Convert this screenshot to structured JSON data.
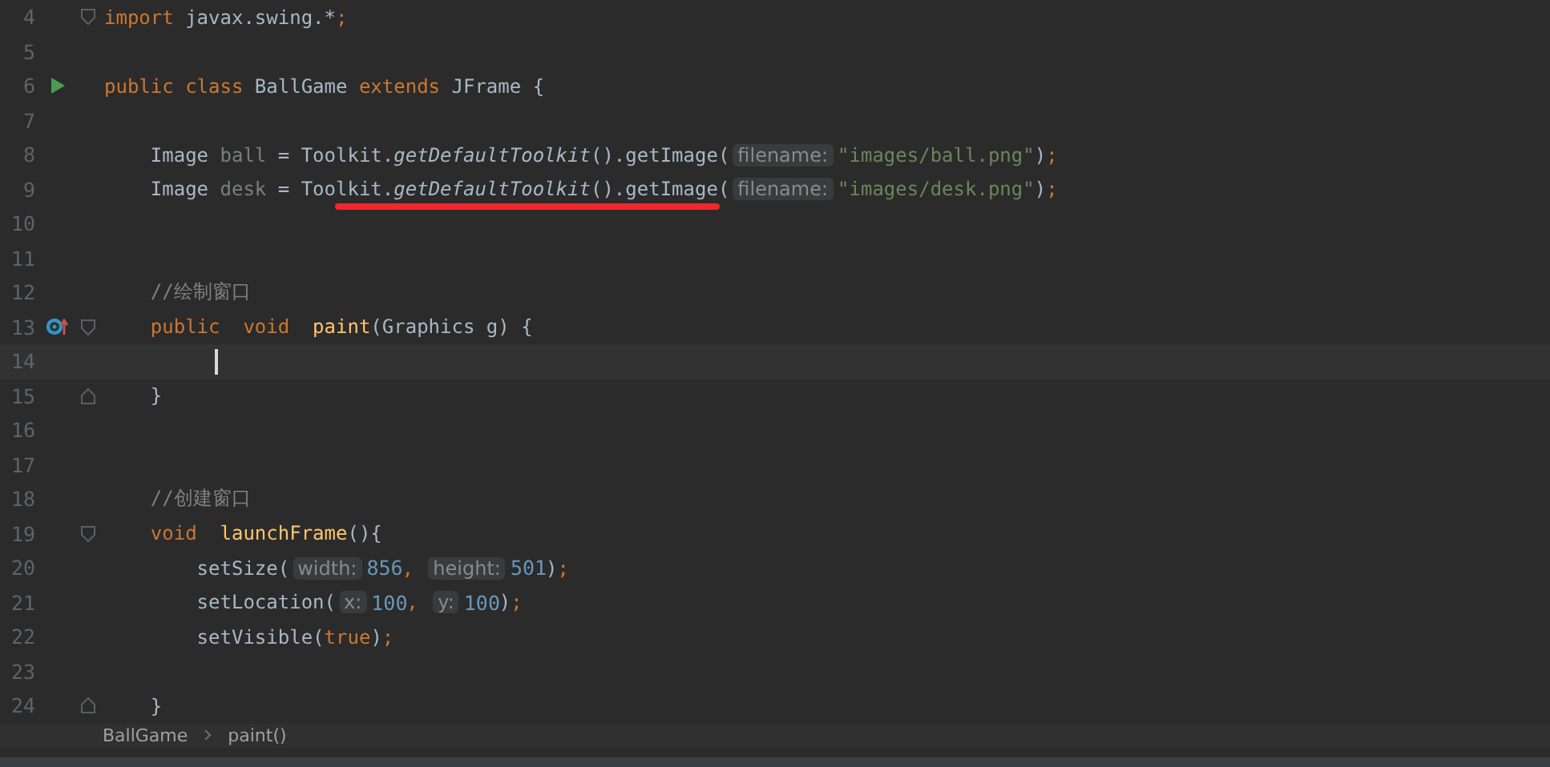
{
  "editor": {
    "lines": [
      {
        "number": "4",
        "fold_start": true,
        "tokens": [
          {
            "kind": "keyword",
            "text": "import "
          },
          {
            "kind": "plain",
            "text": "javax.swing.*"
          },
          {
            "kind": "keyword",
            "text": ";"
          }
        ]
      },
      {
        "number": "5"
      },
      {
        "number": "6",
        "runnable": true,
        "tokens": [
          {
            "kind": "keyword",
            "text": "public class "
          },
          {
            "kind": "plain",
            "text": "BallGame "
          },
          {
            "kind": "keyword",
            "text": "extends "
          },
          {
            "kind": "plain",
            "text": "JFrame {"
          }
        ]
      },
      {
        "number": "7"
      },
      {
        "number": "8",
        "tokens": [
          {
            "kind": "plain",
            "text": "    Image "
          },
          {
            "kind": "unused",
            "text": "ball"
          },
          {
            "kind": "plain",
            "text": " = Toolkit."
          },
          {
            "kind": "static",
            "text": "getDefaultToolkit"
          },
          {
            "kind": "plain",
            "text": "().getImage("
          },
          {
            "kind": "hint",
            "text": "filename:"
          },
          {
            "kind": "string",
            "text": "\"images/ball.png\""
          },
          {
            "kind": "plain",
            "text": ")"
          },
          {
            "kind": "keyword",
            "text": ";"
          }
        ]
      },
      {
        "number": "9",
        "underline": true,
        "tokens": [
          {
            "kind": "plain",
            "text": "    Image "
          },
          {
            "kind": "unused",
            "text": "desk"
          },
          {
            "kind": "plain",
            "text": " = Toolkit."
          },
          {
            "kind": "static",
            "text": "getDefaultToolkit"
          },
          {
            "kind": "plain",
            "text": "().getImage("
          },
          {
            "kind": "hint",
            "text": "filename:"
          },
          {
            "kind": "string",
            "text": "\"images/desk.png\""
          },
          {
            "kind": "plain",
            "text": ")"
          },
          {
            "kind": "keyword",
            "text": ";"
          }
        ]
      },
      {
        "number": "10"
      },
      {
        "number": "11"
      },
      {
        "number": "12",
        "tokens": [
          {
            "kind": "comment",
            "text": "    //绘制窗口"
          }
        ]
      },
      {
        "number": "13",
        "overrides": true,
        "fold_start": true,
        "tokens": [
          {
            "kind": "keyword",
            "text": "    public  void  "
          },
          {
            "kind": "method",
            "text": "paint"
          },
          {
            "kind": "plain",
            "text": "(Graphics g) {"
          }
        ]
      },
      {
        "number": "14",
        "current": true
      },
      {
        "number": "15",
        "fold_end": true,
        "tokens": [
          {
            "kind": "plain",
            "text": "    }"
          }
        ]
      },
      {
        "number": "16"
      },
      {
        "number": "17"
      },
      {
        "number": "18",
        "tokens": [
          {
            "kind": "comment",
            "text": "    //创建窗口"
          }
        ]
      },
      {
        "number": "19",
        "fold_start": true,
        "tokens": [
          {
            "kind": "keyword",
            "text": "    void  "
          },
          {
            "kind": "method",
            "text": "launchFrame"
          },
          {
            "kind": "plain",
            "text": "(){"
          }
        ]
      },
      {
        "number": "20",
        "tokens": [
          {
            "kind": "plain",
            "text": "        setSize("
          },
          {
            "kind": "hint",
            "text": "width:"
          },
          {
            "kind": "number",
            "text": "856"
          },
          {
            "kind": "keyword",
            "text": ", "
          },
          {
            "kind": "hint",
            "text": "height:"
          },
          {
            "kind": "number",
            "text": "501"
          },
          {
            "kind": "plain",
            "text": ")"
          },
          {
            "kind": "keyword",
            "text": ";"
          }
        ]
      },
      {
        "number": "21",
        "tokens": [
          {
            "kind": "plain",
            "text": "        setLocation("
          },
          {
            "kind": "hint",
            "text": "x:"
          },
          {
            "kind": "number",
            "text": "100"
          },
          {
            "kind": "keyword",
            "text": ", "
          },
          {
            "kind": "hint",
            "text": "y:"
          },
          {
            "kind": "number",
            "text": "100"
          },
          {
            "kind": "plain",
            "text": ")"
          },
          {
            "kind": "keyword",
            "text": ";"
          }
        ]
      },
      {
        "number": "22",
        "tokens": [
          {
            "kind": "plain",
            "text": "        setVisible("
          },
          {
            "kind": "keyword",
            "text": "true"
          },
          {
            "kind": "plain",
            "text": ")"
          },
          {
            "kind": "keyword",
            "text": ";"
          }
        ]
      },
      {
        "number": "23"
      },
      {
        "number": "24",
        "fold_end": true,
        "tokens": [
          {
            "kind": "plain",
            "text": "    }"
          }
        ]
      }
    ]
  },
  "breadcrumbs": [
    "BallGame",
    "paint()"
  ]
}
